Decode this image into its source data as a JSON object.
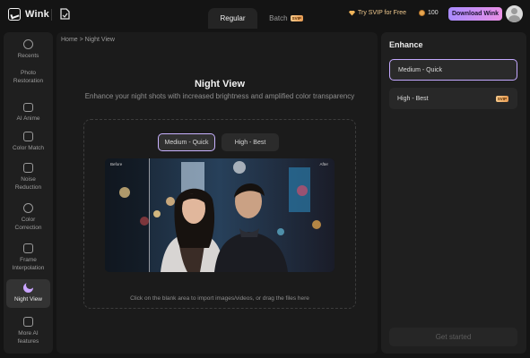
{
  "app": {
    "name": "Wink"
  },
  "header": {
    "tabs": [
      {
        "label": "Regular",
        "active": true
      },
      {
        "label": "Batch",
        "badge": "SVIP",
        "active": false
      }
    ],
    "try_svip": "Try SVIP for Free",
    "credits": "100",
    "download_label": "Download Wink"
  },
  "sidebar": {
    "items": [
      {
        "label": "Recents",
        "icon": "clock-icon"
      },
      {
        "label": "Photo Restoration",
        "icon": "photo-restore-icon"
      },
      {
        "label": "AI Anime",
        "icon": "anime-icon"
      },
      {
        "label": "Color Match",
        "icon": "color-match-icon"
      },
      {
        "label": "Noise Reduction",
        "icon": "noise-icon"
      },
      {
        "label": "Color Correction",
        "icon": "color-correction-icon"
      },
      {
        "label": "Frame Interpolation",
        "icon": "frame-icon"
      },
      {
        "label": "Night View",
        "icon": "moon-icon",
        "active": true
      },
      {
        "label": "More AI features",
        "icon": "more-icon"
      }
    ]
  },
  "main": {
    "breadcrumb": "Home > Night View",
    "title": "Night View",
    "subtitle": "Enhance your night shots with increased brightness and amplified color transparency",
    "quality_tabs": [
      {
        "label": "Medium - Quick",
        "selected": true
      },
      {
        "label": "High - Best",
        "selected": false
      }
    ],
    "preview": {
      "before_label": "Before",
      "after_label": "After"
    },
    "hint": "Click on the blank area to import images/videos, or drag the files here"
  },
  "enhance": {
    "title": "Enhance",
    "options": [
      {
        "label": "Medium - Quick",
        "selected": true
      },
      {
        "label": "High - Best",
        "badge": "SVIP",
        "selected": false
      }
    ],
    "start_label": "Get started"
  },
  "colors": {
    "accent": "#c4a9ff",
    "svip_badge": "#f0b45a",
    "download_gradient_start": "#a98cff",
    "download_gradient_end": "#ea90e6"
  }
}
